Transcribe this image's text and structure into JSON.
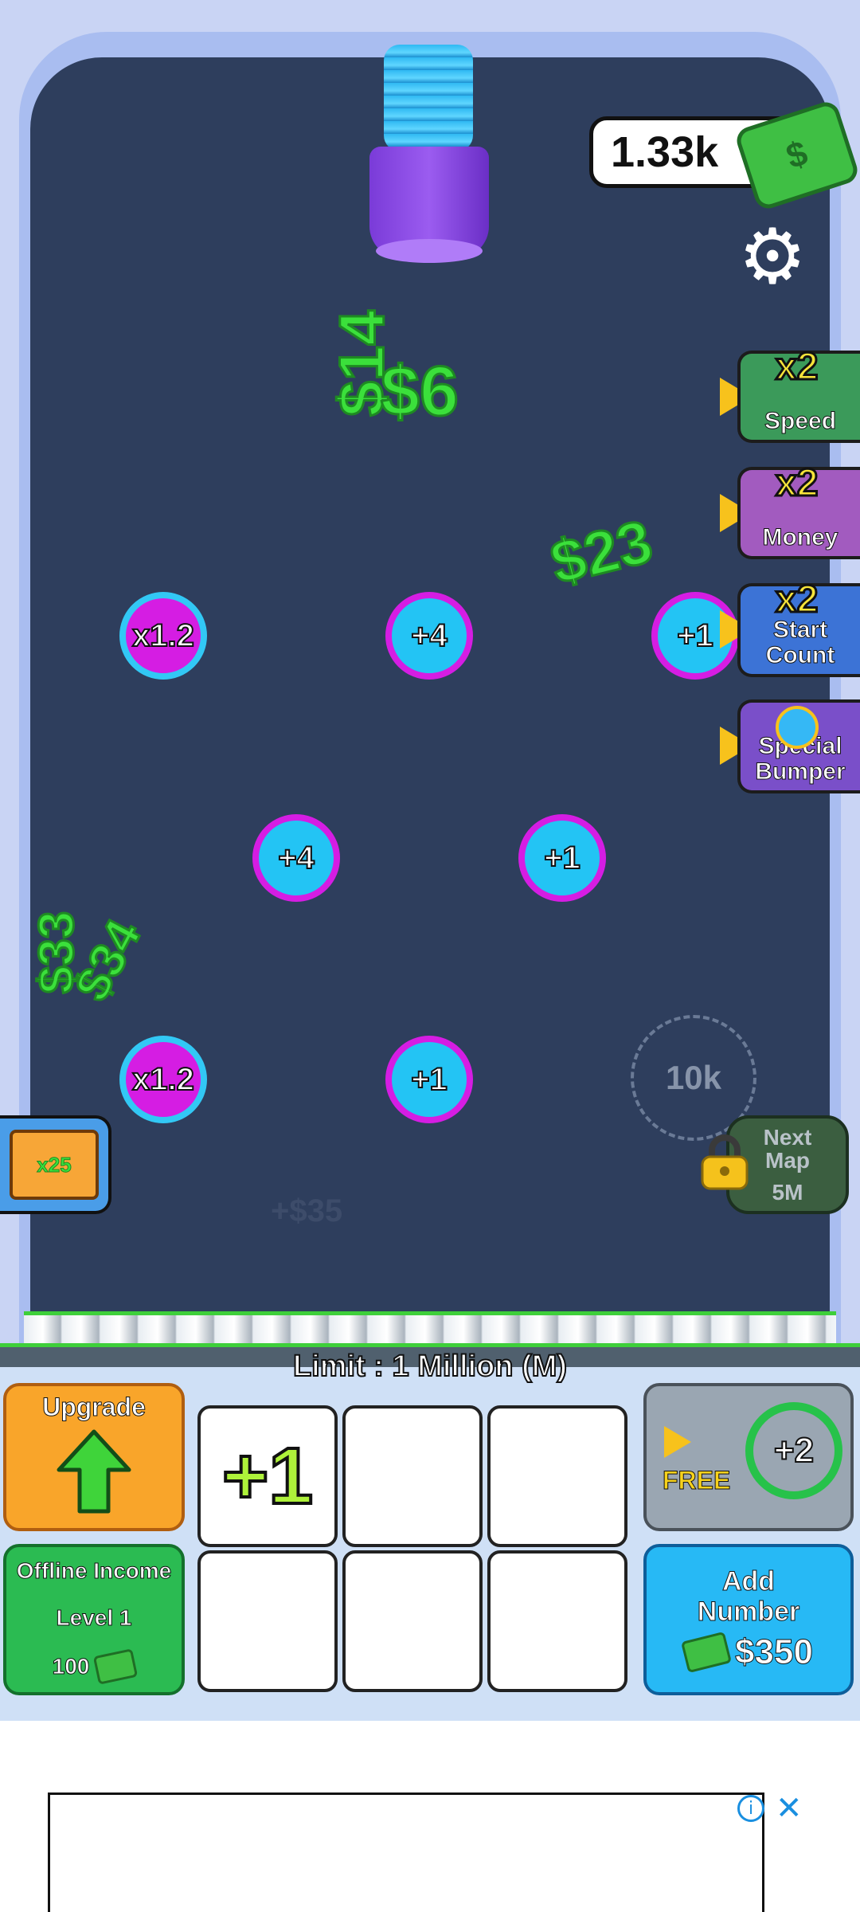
{
  "hud": {
    "money": "1.33k"
  },
  "floating_texts": [
    "$14",
    "$6",
    "$23",
    "$33",
    "$34",
    "+$35"
  ],
  "pegs": [
    {
      "label": "x1.2",
      "type": "mult"
    },
    {
      "label": "+4",
      "type": "add"
    },
    {
      "label": "+1",
      "type": "add"
    },
    {
      "label": "+4",
      "type": "add"
    },
    {
      "label": "+1",
      "type": "add"
    },
    {
      "label": "x1.2",
      "type": "mult"
    },
    {
      "label": "+1",
      "type": "add"
    }
  ],
  "locked_peg": {
    "label": "10k"
  },
  "side_buttons": {
    "speed": {
      "badge": "x2",
      "label": "Speed",
      "color": "#3b9a5a"
    },
    "money": {
      "badge": "x2",
      "label": "Money",
      "color": "#a25bbf"
    },
    "start_count": {
      "badge": "x2",
      "label": "Start Count",
      "color": "#3c73d6"
    },
    "special_bumper": {
      "label": "Special Bumper",
      "color": "#7a4fc9"
    }
  },
  "next_map": {
    "label": "Next Map",
    "price": "5M"
  },
  "limit_text": "Limit : 1 Million (M)",
  "upgrade": {
    "label": "Upgrade"
  },
  "offline": {
    "title": "Offline Income",
    "level": "Level 1",
    "cost": "100"
  },
  "slots": [
    "+1",
    "",
    "",
    "",
    "",
    ""
  ],
  "free_button": {
    "label": "FREE",
    "value": "+2"
  },
  "add_number": {
    "title": "Add Number",
    "price": "$350"
  }
}
